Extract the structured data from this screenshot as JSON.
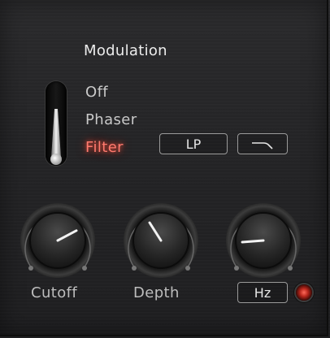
{
  "modulation": {
    "title": "Modulation",
    "modes": [
      "Off",
      "Phaser",
      "Filter"
    ],
    "selected_mode": "Filter",
    "active_color": "#ff7a6e"
  },
  "filter": {
    "type_label": "LP",
    "shape_icon": "lowpass-curve-icon"
  },
  "knobs": {
    "cutoff": {
      "label": "Cutoff",
      "value_fraction": 0.73
    },
    "depth": {
      "label": "Depth",
      "value_fraction": 0.38
    },
    "rate": {
      "label": "",
      "value_fraction": 0.15
    }
  },
  "rate_unit": {
    "label": "Hz"
  },
  "sync_led": {
    "state": "on",
    "color": "#e0392b"
  }
}
